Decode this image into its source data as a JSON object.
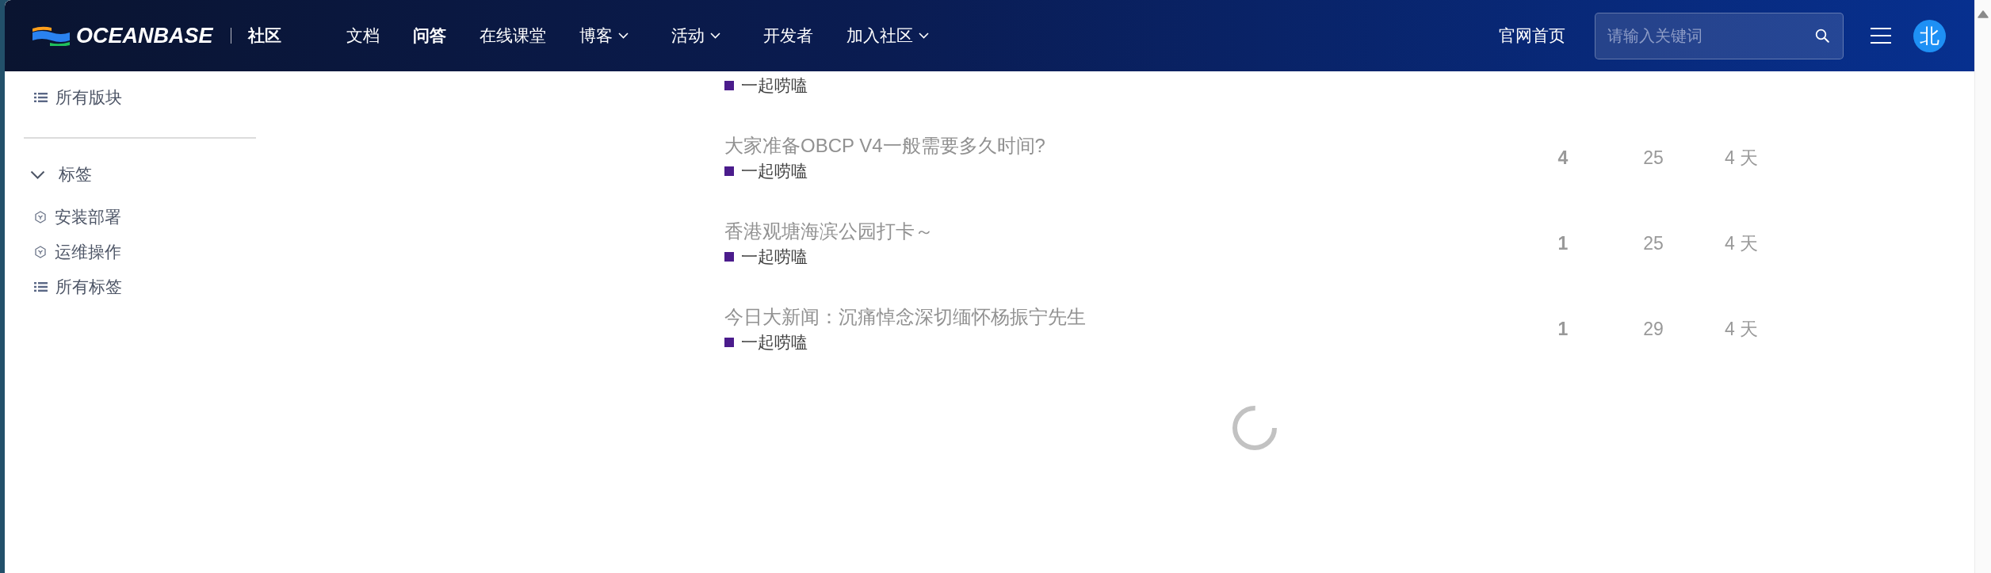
{
  "header": {
    "logo": "OCEANBASE",
    "section": "社区",
    "nav": [
      {
        "label": "文档",
        "kind": "link",
        "selected": false
      },
      {
        "label": "问答",
        "kind": "link",
        "selected": true
      },
      {
        "label": "在线课堂",
        "kind": "link",
        "selected": false
      },
      {
        "label": "博客",
        "kind": "dropdown",
        "selected": false
      },
      {
        "label": "活动",
        "kind": "dropdown",
        "selected": false
      },
      {
        "label": "开发者",
        "kind": "link",
        "selected": false
      },
      {
        "label": "加入社区",
        "kind": "dropdown",
        "selected": false
      }
    ],
    "home_link": "官网首页",
    "search": {
      "placeholder": "请输入关键词"
    },
    "avatar": "北"
  },
  "sidebar": {
    "links": [
      {
        "kind": "list",
        "label": "所有版块"
      }
    ],
    "tags": {
      "label": "标签",
      "expanded": true,
      "items": [
        {
          "kind": "tag",
          "label": "安装部署"
        },
        {
          "kind": "tag",
          "label": "运维操作"
        },
        {
          "kind": "list",
          "label": "所有标签"
        }
      ]
    }
  },
  "topics": [
    {
      "category": {
        "name": "一起唠嗑",
        "color": "#4b1c8c"
      }
    },
    {
      "title": "大家准备OBCP V4一般需要多久时间?",
      "category": {
        "name": "一起唠嗑",
        "color": "#4b1c8c"
      },
      "replies": "4",
      "views": "25",
      "activity": "4 天"
    },
    {
      "title": "香港观塘海滨公园打卡～",
      "category": {
        "name": "一起唠嗑",
        "color": "#4b1c8c"
      },
      "replies": "1",
      "views": "25",
      "activity": "4 天"
    },
    {
      "title": "今日大新闻：沉痛悼念深切缅怀杨振宁先生",
      "category": {
        "name": "一起唠嗑",
        "color": "#4b1c8c"
      },
      "replies": "1",
      "views": "29",
      "activity": "4 天"
    }
  ],
  "loading": true
}
